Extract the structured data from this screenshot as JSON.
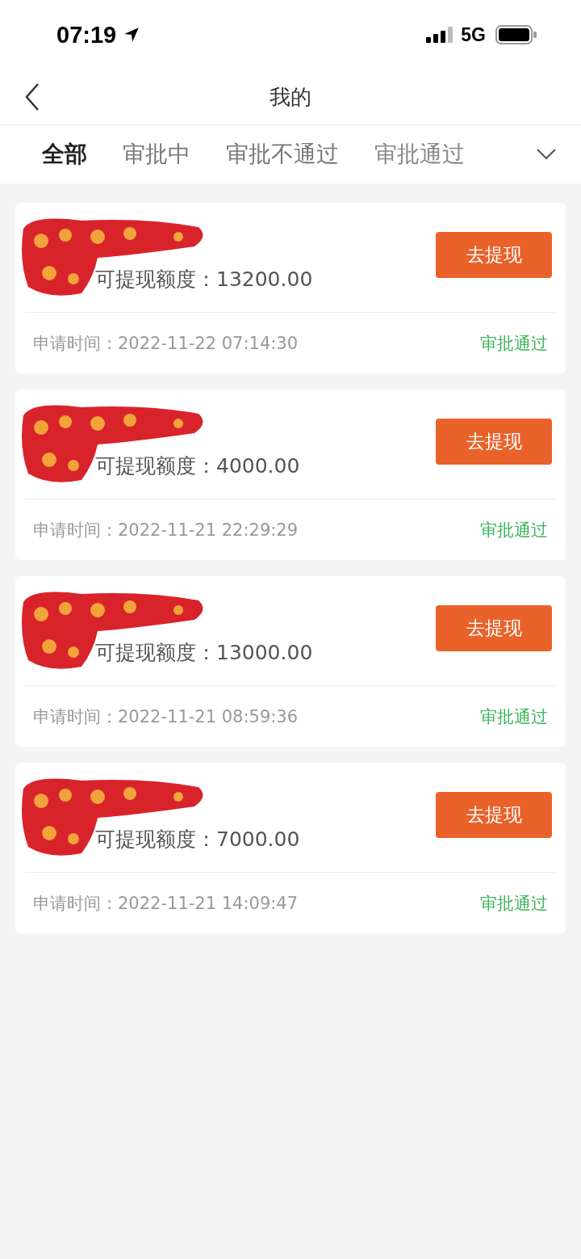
{
  "status_bar": {
    "time": "07:19",
    "network": "5G"
  },
  "header": {
    "title": "我的"
  },
  "tabs": [
    {
      "label": "全部",
      "selected": true
    },
    {
      "label": "审批中",
      "selected": false
    },
    {
      "label": "审批不通过",
      "selected": false
    },
    {
      "label": "审批通过",
      "selected": false
    }
  ],
  "records": [
    {
      "amount_label": "可提现额度：",
      "amount": "13200.00",
      "button": "去提现",
      "time_label": "申请时间：",
      "time": "2022-11-22 07:14:30",
      "status": "审批通过",
      "color": "#3cb55c"
    },
    {
      "amount_label": "可提现额度：",
      "amount": "4000.00",
      "button": "去提现",
      "time_label": "申请时间：",
      "time": "2022-11-21 22:29:29",
      "status": "审批通过",
      "color": "#3cb55c"
    },
    {
      "amount_label": "可提现额度：",
      "amount": "13000.00",
      "button": "去提现",
      "time_label": "申请时间：",
      "time": "2022-11-21 08:59:36",
      "status": "审批通过",
      "color": "#3cb55c"
    },
    {
      "amount_label": "可提现额度：",
      "amount": "7000.00",
      "button": "去提现",
      "time_label": "申请时间：",
      "time": "2022-11-21 14:09:47",
      "status": "审批通过",
      "color": "#3cb55c"
    }
  ]
}
